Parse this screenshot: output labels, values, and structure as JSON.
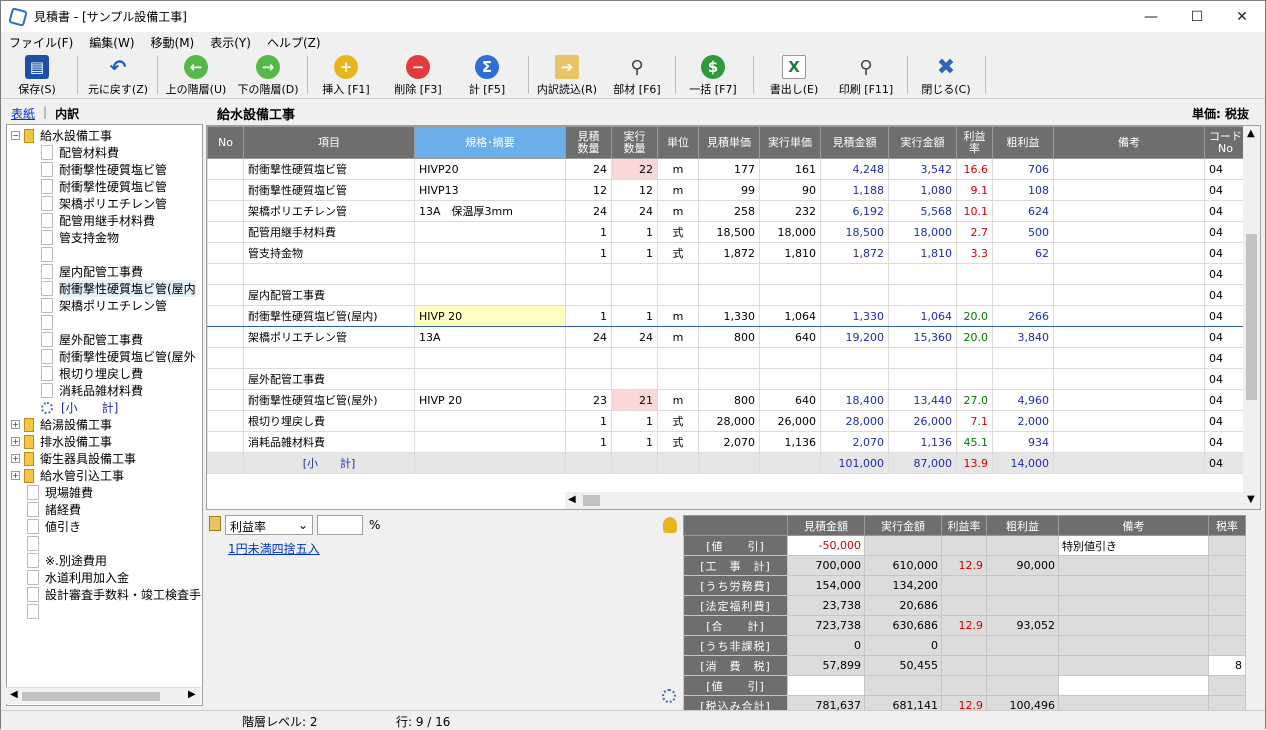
{
  "window": {
    "title": "見積書 - [サンプル設備工事]"
  },
  "menu": [
    "ファイル(F)",
    "編集(W)",
    "移動(M)",
    "表示(Y)",
    "ヘルプ(Z)"
  ],
  "toolbar": [
    "保存(S)",
    "元に戻す(Z)",
    "上の階層(U)",
    "下の階層(D)",
    "挿入 [F1]",
    "削除 [F3]",
    "計 [F5]",
    "内訳読込(R)",
    "部材 [F6]",
    "一括 [F7]",
    "書出し(E)",
    "印刷 [F11]",
    "閉じる(C)"
  ],
  "tabs": {
    "summary": "表紙",
    "detail": "内訳"
  },
  "tree": [
    {
      "label": "給水設備工事",
      "type": "folder",
      "expanded": true,
      "indent": 0
    },
    {
      "label": "配管材料費",
      "type": "doc",
      "indent": 1
    },
    {
      "label": "耐衝撃性硬質塩ビ管",
      "type": "doc",
      "indent": 1
    },
    {
      "label": "耐衝撃性硬質塩ビ管",
      "type": "doc",
      "indent": 1
    },
    {
      "label": "架橋ポリエチレン管",
      "type": "doc",
      "indent": 1
    },
    {
      "label": "配管用継手材料費",
      "type": "doc",
      "indent": 1
    },
    {
      "label": "管支持金物",
      "type": "doc",
      "indent": 1
    },
    {
      "label": "",
      "type": "doc",
      "indent": 1
    },
    {
      "label": "屋内配管工事費",
      "type": "doc",
      "indent": 1
    },
    {
      "label": "耐衝撃性硬質塩ビ管(屋内",
      "type": "doc",
      "indent": 1,
      "selected": true
    },
    {
      "label": "架橋ポリエチレン管",
      "type": "doc",
      "indent": 1
    },
    {
      "label": "",
      "type": "doc",
      "indent": 1
    },
    {
      "label": "屋外配管工事費",
      "type": "doc",
      "indent": 1
    },
    {
      "label": "耐衝撃性硬質塩ビ管(屋外",
      "type": "doc",
      "indent": 1
    },
    {
      "label": "根切り埋戻し費",
      "type": "doc",
      "indent": 1
    },
    {
      "label": "消耗品雑材料費",
      "type": "doc",
      "indent": 1
    },
    {
      "label": "[小　　計]",
      "type": "gear",
      "indent": 1
    },
    {
      "label": "給湯設備工事",
      "type": "folder",
      "expanded": false,
      "indent": 0
    },
    {
      "label": "排水設備工事",
      "type": "folder",
      "expanded": false,
      "indent": 0
    },
    {
      "label": "衛生器具設備工事",
      "type": "folder",
      "expanded": false,
      "indent": 0
    },
    {
      "label": "給水管引込工事",
      "type": "folder",
      "expanded": false,
      "indent": 0
    },
    {
      "label": "現場雑費",
      "type": "doc",
      "indent": 0
    },
    {
      "label": "諸経費",
      "type": "doc",
      "indent": 0
    },
    {
      "label": "値引き",
      "type": "doc",
      "indent": 0
    },
    {
      "label": "",
      "type": "doc",
      "indent": 0
    },
    {
      "label": "※.別途費用",
      "type": "doc",
      "indent": 0
    },
    {
      "label": "水道利用加入金",
      "type": "doc",
      "indent": 0
    },
    {
      "label": "設計審査手数料・竣工検査手",
      "type": "doc",
      "indent": 0
    },
    {
      "label": "",
      "type": "doc",
      "indent": 0
    }
  ],
  "main": {
    "title": "給水設備工事",
    "unit": "単価: 税抜"
  },
  "columns": [
    "No",
    "項目",
    "規格･摘要",
    "見積\n数量",
    "実行\n数量",
    "単位",
    "見積単価",
    "実行単価",
    "見積金額",
    "実行金額",
    "利益\n率",
    "粗利益",
    "備考",
    "コード\nNo"
  ],
  "rows": [
    {
      "item": "耐衝撃性硬質塩ビ管",
      "spec": "HIVP20",
      "eq": "24",
      "aq": "22",
      "unit": "m",
      "ep": "177",
      "ap": "161",
      "ea": "4,248",
      "aa": "3,542",
      "rate": "16.6",
      "gp": "706",
      "code": "04",
      "aqpink": true,
      "ratecolor": "red"
    },
    {
      "item": "耐衝撃性硬質塩ビ管",
      "spec": "HIVP13",
      "eq": "12",
      "aq": "12",
      "unit": "m",
      "ep": "99",
      "ap": "90",
      "ea": "1,188",
      "aa": "1,080",
      "rate": "9.1",
      "gp": "108",
      "code": "04",
      "ratecolor": "red"
    },
    {
      "item": "架橋ポリエチレン管",
      "spec": "13A　保温厚3mm",
      "eq": "24",
      "aq": "24",
      "unit": "m",
      "ep": "258",
      "ap": "232",
      "ea": "6,192",
      "aa": "5,568",
      "rate": "10.1",
      "gp": "624",
      "code": "04",
      "ratecolor": "red"
    },
    {
      "item": "配管用継手材料費",
      "spec": "",
      "eq": "1",
      "aq": "1",
      "unit": "式",
      "ep": "18,500",
      "ap": "18,000",
      "ea": "18,500",
      "aa": "18,000",
      "rate": "2.7",
      "gp": "500",
      "code": "04",
      "ratecolor": "red"
    },
    {
      "item": "管支持金物",
      "spec": "",
      "eq": "1",
      "aq": "1",
      "unit": "式",
      "ep": "1,872",
      "ap": "1,810",
      "ea": "1,872",
      "aa": "1,810",
      "rate": "3.3",
      "gp": "62",
      "code": "04",
      "ratecolor": "red"
    },
    {
      "item": "",
      "spec": "",
      "eq": "",
      "aq": "",
      "unit": "",
      "ep": "",
      "ap": "",
      "ea": "",
      "aa": "",
      "rate": "",
      "gp": "",
      "code": "04"
    },
    {
      "item": "屋内配管工事費",
      "spec": "",
      "eq": "",
      "aq": "",
      "unit": "",
      "ep": "",
      "ap": "",
      "ea": "",
      "aa": "",
      "rate": "",
      "gp": "",
      "code": "04"
    },
    {
      "item": "耐衝撃性硬質塩ビ管(屋内)",
      "spec": "HIVP 20",
      "eq": "1",
      "aq": "1",
      "unit": "m",
      "ep": "1,330",
      "ap": "1,064",
      "ea": "1,330",
      "aa": "1,064",
      "rate": "20.0",
      "gp": "266",
      "code": "04",
      "current": true,
      "ratecolor": "green"
    },
    {
      "item": "架橋ポリエチレン管",
      "spec": "13A",
      "eq": "24",
      "aq": "24",
      "unit": "m",
      "ep": "800",
      "ap": "640",
      "ea": "19,200",
      "aa": "15,360",
      "rate": "20.0",
      "gp": "3,840",
      "code": "04",
      "ratecolor": "green"
    },
    {
      "item": "",
      "spec": "",
      "eq": "",
      "aq": "",
      "unit": "",
      "ep": "",
      "ap": "",
      "ea": "",
      "aa": "",
      "rate": "",
      "gp": "",
      "code": "04"
    },
    {
      "item": "屋外配管工事費",
      "spec": "",
      "eq": "",
      "aq": "",
      "unit": "",
      "ep": "",
      "ap": "",
      "ea": "",
      "aa": "",
      "rate": "",
      "gp": "",
      "code": "04"
    },
    {
      "item": "耐衝撃性硬質塩ビ管(屋外)",
      "spec": "HIVP 20",
      "eq": "23",
      "aq": "21",
      "unit": "m",
      "ep": "800",
      "ap": "640",
      "ea": "18,400",
      "aa": "13,440",
      "rate": "27.0",
      "gp": "4,960",
      "code": "04",
      "aqpink": true,
      "ratecolor": "green"
    },
    {
      "item": "根切り埋戻し費",
      "spec": "",
      "eq": "1",
      "aq": "1",
      "unit": "式",
      "ep": "28,000",
      "ap": "26,000",
      "ea": "28,000",
      "aa": "26,000",
      "rate": "7.1",
      "gp": "2,000",
      "code": "04",
      "ratecolor": "red"
    },
    {
      "item": "消耗品雑材料費",
      "spec": "",
      "eq": "1",
      "aq": "1",
      "unit": "式",
      "ep": "2,070",
      "ap": "1,136",
      "ea": "2,070",
      "aa": "1,136",
      "rate": "45.1",
      "gp": "934",
      "code": "04",
      "ratecolor": "green"
    },
    {
      "item": "[小　　計]",
      "spec": "",
      "eq": "",
      "aq": "",
      "unit": "",
      "ep": "",
      "ap": "",
      "ea": "101,000",
      "aa": "87,000",
      "rate": "13.9",
      "gp": "14,000",
      "code": "04",
      "subtotal": true,
      "ratecolor": "red"
    }
  ],
  "lower": {
    "select_value": "利益率",
    "pct": "%",
    "round_link": "1円未満四捨五入"
  },
  "summary": {
    "columns": [
      "",
      "見積金額",
      "実行金額",
      "利益率",
      "粗利益",
      "備考",
      "税率"
    ],
    "rows": [
      {
        "label": "[値　　引]",
        "est": "-50,000",
        "act": "",
        "rate": "",
        "gp": "",
        "note": "特別値引き",
        "tax": "",
        "estred": true,
        "white": true
      },
      {
        "label": "[工　事　計]",
        "est": "700,000",
        "act": "610,000",
        "rate": "12.9",
        "gp": "90,000",
        "note": "",
        "tax": ""
      },
      {
        "label": "[うち労務費]",
        "est": "154,000",
        "act": "134,200",
        "rate": "",
        "gp": "",
        "note": "",
        "tax": ""
      },
      {
        "label": "[法定福利費]",
        "est": "23,738",
        "act": "20,686",
        "rate": "",
        "gp": "",
        "note": "",
        "tax": ""
      },
      {
        "label": "[合　　計]",
        "est": "723,738",
        "act": "630,686",
        "rate": "12.9",
        "gp": "93,052",
        "note": "",
        "tax": ""
      },
      {
        "label": "[うち非課税]",
        "est": "0",
        "act": "0",
        "rate": "",
        "gp": "",
        "note": "",
        "tax": ""
      },
      {
        "label": "[消　費　税]",
        "est": "57,899",
        "act": "50,455",
        "rate": "",
        "gp": "",
        "note": "",
        "tax": "8"
      },
      {
        "label": "[値　　引]",
        "est": "",
        "act": "",
        "rate": "",
        "gp": "",
        "note": "",
        "tax": "",
        "white": true
      },
      {
        "label": "[税込み合計]",
        "est": "781,637",
        "act": "681,141",
        "rate": "12.9",
        "gp": "100,496",
        "note": "",
        "tax": ""
      }
    ]
  },
  "status": {
    "level": "階層レベル: 2",
    "row": "行: 9 / 16"
  }
}
